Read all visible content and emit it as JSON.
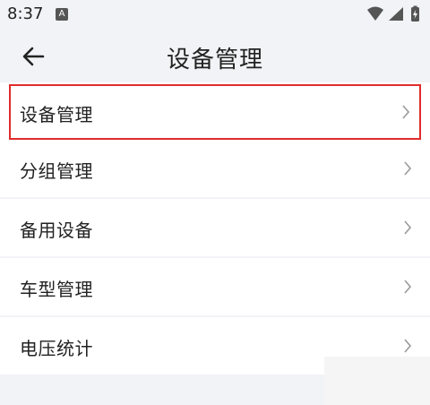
{
  "status_bar": {
    "time": "8:37",
    "a_badge": "A",
    "icons": [
      "wifi-icon",
      "signal-icon",
      "battery-icon"
    ]
  },
  "header": {
    "title": "设备管理",
    "back_icon": "arrow-left-icon"
  },
  "menu": {
    "items": [
      {
        "label": "设备管理",
        "highlighted": true
      },
      {
        "label": "分组管理"
      },
      {
        "label": "备用设备"
      },
      {
        "label": "车型管理"
      },
      {
        "label": "电压统计"
      }
    ]
  },
  "colors": {
    "background": "#f1f3f6",
    "item_background": "#ffffff",
    "highlight_border": "#e02b2b",
    "chevron": "#9a9a9a"
  }
}
